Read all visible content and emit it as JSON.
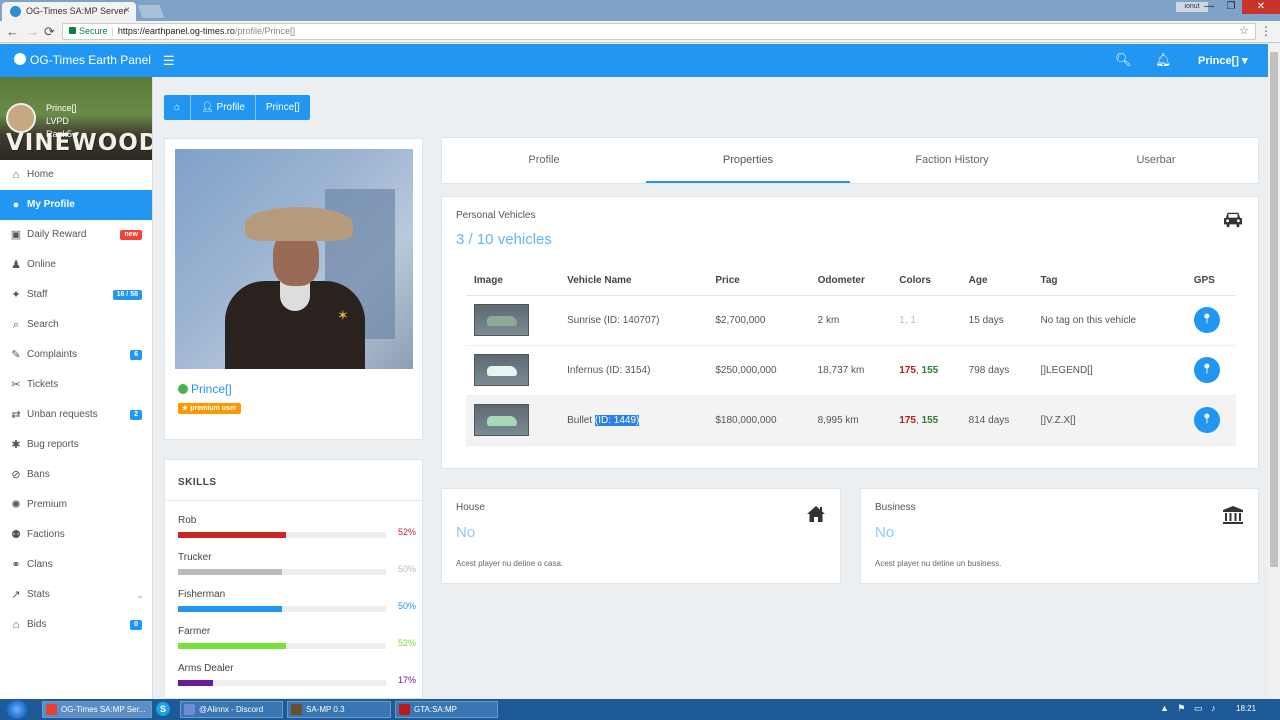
{
  "browser": {
    "tab_title": "OG-Times SA:MP Server",
    "tab_close": "×",
    "user_badge": "ionut",
    "secure_label": "Secure",
    "url_host": "https://earthpanel.og-times.ro",
    "url_path": "/profile/Prince[]",
    "back": "←",
    "forward": "→",
    "reload": "⟳",
    "minimize": "—",
    "maximize": "❐",
    "close": "✕",
    "bookmark": "☆",
    "menu": "⋮"
  },
  "header": {
    "brand": "OG-Times Earth Panel",
    "menu_icon": "☰",
    "search_icon": "🔍︎",
    "bell_icon": "🔔︎",
    "user": "Prince[]",
    "user_caret": "▾"
  },
  "sidebar": {
    "profile": {
      "name": "Prince[]",
      "faction": "LVPD",
      "rank": "Rank5 ▾",
      "banner": "VINEWOOD"
    },
    "items": [
      {
        "label": "Home",
        "icon": "⌂"
      },
      {
        "label": "My Profile",
        "icon": "●"
      },
      {
        "label": "Daily Reward",
        "icon": "▣",
        "badge": "new"
      },
      {
        "label": "Online",
        "icon": "♟"
      },
      {
        "label": "Staff",
        "icon": "✦",
        "badge": "16 / 58"
      },
      {
        "label": "Search",
        "icon": "⌕"
      },
      {
        "label": "Complaints",
        "icon": "✎",
        "badge": "6"
      },
      {
        "label": "Tickets",
        "icon": "✂"
      },
      {
        "label": "Unban requests",
        "icon": "⇄",
        "badge": "2"
      },
      {
        "label": "Bug reports",
        "icon": "✱"
      },
      {
        "label": "Bans",
        "icon": "⊘"
      },
      {
        "label": "Premium",
        "icon": "✺"
      },
      {
        "label": "Factions",
        "icon": "⚉"
      },
      {
        "label": "Clans",
        "icon": "⚭"
      },
      {
        "label": "Stats",
        "icon": "↗",
        "chevron": "⌄"
      },
      {
        "label": "Bids",
        "icon": "⌂",
        "badge": "0"
      }
    ]
  },
  "breadcrumb": {
    "home_icon": "⌂",
    "profile": "Profile",
    "profile_icon": "👤︎",
    "current": "Prince[]"
  },
  "profile_card": {
    "name": "Prince[]",
    "badge": "★ premium user"
  },
  "skills": {
    "title": "SKILLS",
    "items": [
      {
        "name": "Rob",
        "pct_value": 52,
        "pct": "52%",
        "color": "#c62828"
      },
      {
        "name": "Trucker",
        "pct_value": 50,
        "pct": "50%",
        "color": "#bdbdbd"
      },
      {
        "name": "Fisherman",
        "pct_value": 50,
        "pct": "50%",
        "color": "#2196f3"
      },
      {
        "name": "Farmer",
        "pct_value": 52,
        "pct": "52%",
        "color": "#76e33a"
      },
      {
        "name": "Arms Dealer",
        "pct_value": 17,
        "pct": "17%",
        "color": "#6a1b9a"
      }
    ]
  },
  "tabs": [
    {
      "label": "Profile"
    },
    {
      "label": "Properties",
      "active": true
    },
    {
      "label": "Faction History"
    },
    {
      "label": "Userbar"
    }
  ],
  "vehicles": {
    "title": "Personal Vehicles",
    "count": "3 / 10 vehicles",
    "columns": [
      "Image",
      "Vehicle Name",
      "Price",
      "Odometer",
      "Colors",
      "Age",
      "Tag",
      "GPS"
    ],
    "rows": [
      {
        "name": "Sunrise (ID: 140707)",
        "price": "$2,700,000",
        "odometer": "2 km",
        "color1": "1",
        "color2": "1",
        "color_style": "grey",
        "age": "15 days",
        "tag": "No tag on this vehicle",
        "car_color": "#8fa89a"
      },
      {
        "name": "Infernus (ID: 3154)",
        "price": "$250,000,000",
        "odometer": "18,737 km",
        "color1": "175",
        "color2": "155",
        "color_style": "rg",
        "age": "798 days",
        "tag": "[]LEGEND[]",
        "car_color": "#e8f4f2"
      },
      {
        "name_a": "Bullet",
        "name_b": "(ID: 1449)",
        "price": "$180,000,000",
        "odometer": "8,995 km",
        "color1": "175",
        "color2": "155",
        "color_style": "rg",
        "age": "814 days",
        "tag": "[]V.Z.X[]",
        "car_color": "#a7d8b8"
      }
    ],
    "gps_icon": "📍︎"
  },
  "house": {
    "title": "House",
    "value": "No",
    "desc": "Acest player nu detine o casa."
  },
  "business": {
    "title": "Business",
    "value": "No",
    "desc": "Acest player nu detine un business."
  },
  "taskbar": {
    "items": [
      {
        "label": "OG-Times SA:MP Ser...",
        "color": "#e94235"
      },
      {
        "label": "@Alinnx - Discord",
        "color": "#7289da"
      },
      {
        "label": "SA-MP 0.3",
        "color": "#6b4f2a"
      },
      {
        "label": "GTA:SA:MP",
        "color": "#b71c1c"
      }
    ],
    "skype": "S",
    "tray": "▲ ⚑ ▭ ♪",
    "time": "18:21"
  }
}
